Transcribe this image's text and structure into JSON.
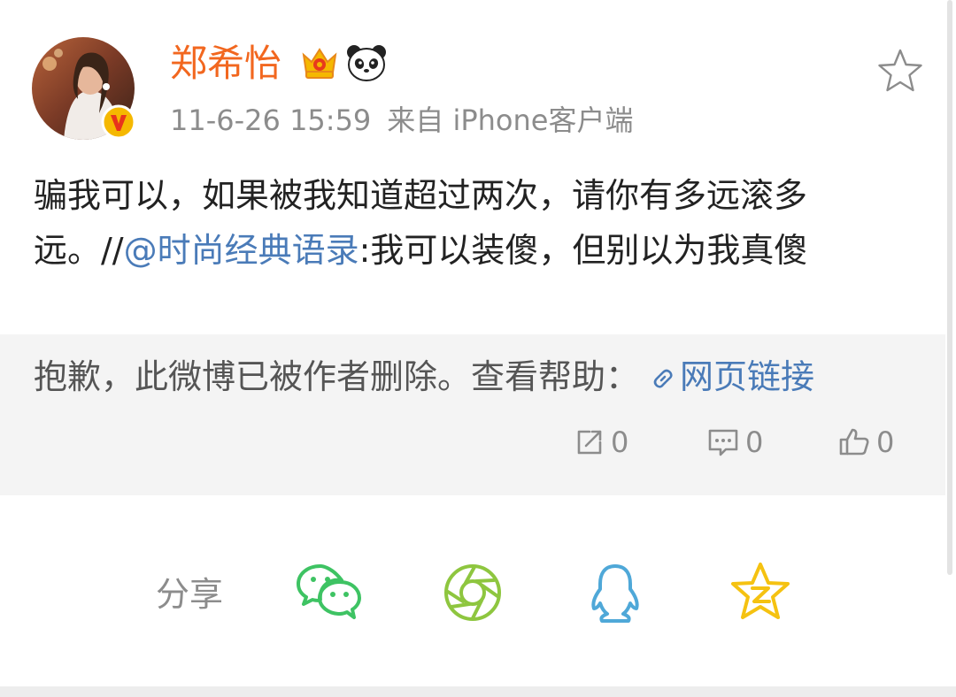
{
  "post": {
    "author": "郑希怡",
    "author_badges": [
      "crown-icon",
      "panda-icon"
    ],
    "timestamp": "11-6-26 15:59",
    "source": "来自 iPhone客户端",
    "text_before": "骗我可以，如果被我知道超过两次，请你有多远滚多远。//",
    "mention": "@时尚经典语录",
    "text_after": ":我可以装傻，但别以为我真傻"
  },
  "retweet": {
    "deleted_notice": "抱歉，此微博已被作者删除。查看帮助：",
    "link_label": "网页链接",
    "repost_count": "0",
    "comment_count": "0",
    "like_count": "0"
  },
  "share": {
    "label": "分享",
    "targets": [
      "wechat-icon",
      "moments-icon",
      "qq-icon",
      "qzone-icon"
    ]
  },
  "colors": {
    "author": "#f2671f",
    "link": "#4a7bb8",
    "meta": "#8c8c8c",
    "retweet_bg": "#f4f4f4",
    "wechat": "#3ec363",
    "moments": "#8ec63f",
    "qq": "#4fa8d8",
    "qzone": "#f5c211"
  }
}
